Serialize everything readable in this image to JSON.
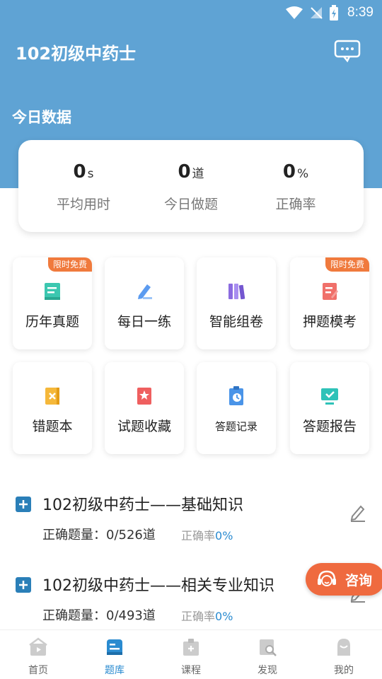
{
  "status_bar": {
    "time": "8:39"
  },
  "header": {
    "title": "102初级中药士",
    "message_icon": "chat-bubble-icon"
  },
  "today": {
    "section_title": "今日数据",
    "stats": [
      {
        "value": "0",
        "unit": "s",
        "label": "平均用时"
      },
      {
        "value": "0",
        "unit": "道",
        "label": "今日做题"
      },
      {
        "value": "0",
        "unit": "%",
        "label": "正确率"
      }
    ]
  },
  "tiles": [
    {
      "label": "历年真题",
      "badge": "限时免费",
      "icon": "book-icon",
      "color": "#3cc7b0"
    },
    {
      "label": "每日一练",
      "badge": "",
      "icon": "pencil-icon",
      "color": "#5b9bf0"
    },
    {
      "label": "智能组卷",
      "badge": "",
      "icon": "books-icon",
      "color": "#8b6be0"
    },
    {
      "label": "押题模考",
      "badge": "限时免费",
      "icon": "exam-paper-icon",
      "color": "#f0706a"
    },
    {
      "label": "错题本",
      "badge": "",
      "icon": "error-note-icon",
      "color": "#f5b83a"
    },
    {
      "label": "试题收藏",
      "badge": "",
      "icon": "favorite-note-icon",
      "color": "#ef5f5f"
    },
    {
      "label": "答题记录",
      "badge": "",
      "icon": "clipboard-clock-icon",
      "color": "#4a94e8"
    },
    {
      "label": "答题报告",
      "badge": "",
      "icon": "monitor-check-icon",
      "color": "#2ec2b8"
    }
  ],
  "subjects": [
    {
      "title": "102初级中药士——基础知识",
      "count_label": "正确题量：0/526道",
      "rate_label": "正确率",
      "rate_value": "0%"
    },
    {
      "title": "102初级中药士——相关专业知识",
      "count_label": "正确题量：0/493道",
      "rate_label": "正确率",
      "rate_value": "0%"
    }
  ],
  "consult": {
    "label": "咨询"
  },
  "tabbar": [
    {
      "label": "首页",
      "icon": "home-icon",
      "active": false
    },
    {
      "label": "题库",
      "icon": "question-bank-icon",
      "active": true
    },
    {
      "label": "课程",
      "icon": "course-icon",
      "active": false
    },
    {
      "label": "发现",
      "icon": "discover-icon",
      "active": false
    },
    {
      "label": "我的",
      "icon": "profile-icon",
      "active": false
    }
  ],
  "colors": {
    "header": "#5fa3d4",
    "accent": "#2a8bd0",
    "badge": "#f07a3d",
    "consult": "#ef6a3f"
  }
}
